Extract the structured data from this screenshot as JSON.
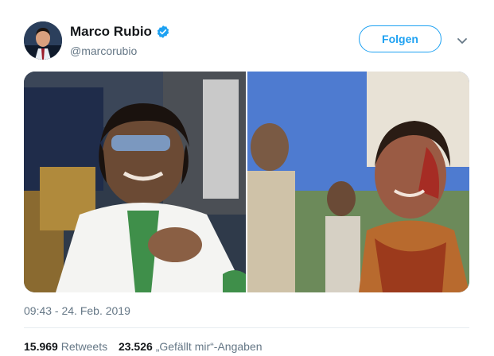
{
  "author": {
    "display_name": "Marco Rubio",
    "handle": "@marcorubio",
    "verified": true
  },
  "actions": {
    "follow_label": "Folgen"
  },
  "tweet": {
    "timestamp": "09:43 - 24. Feb. 2019"
  },
  "stats": {
    "retweets_count": "15.969",
    "retweets_label": "Retweets",
    "likes_count": "23.526",
    "likes_label": "„Gefällt mir“-Angaben"
  },
  "colors": {
    "accent": "#1da1f2",
    "secondary_text": "#657786",
    "primary_text": "#14171a",
    "divider": "#e6ecf0"
  },
  "icons": {
    "verified": "verified-badge-icon",
    "caret": "chevron-down-icon"
  }
}
